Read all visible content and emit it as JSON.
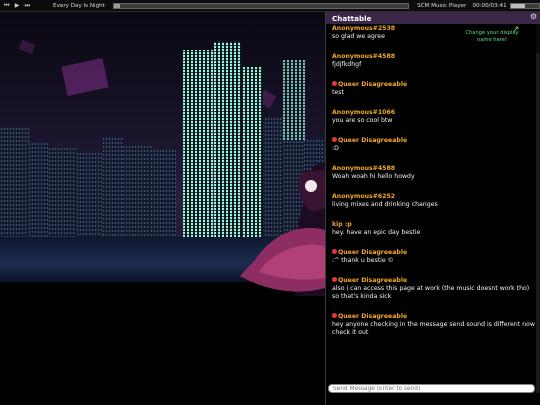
{
  "player": {
    "prev_icon": "skip-back-icon",
    "play_icon": "play-icon",
    "next_icon": "skip-forward-icon",
    "track_title": "Every Day Is Night",
    "progress": 0.02,
    "player_name": "SCM Music Player",
    "time": "00:00/03:41",
    "volume": 0.5
  },
  "chat": {
    "title": "Chattable",
    "settings_icon": "gear-icon",
    "tip": "Change your display name here!",
    "input_placeholder": "Send Message (Enter to send)",
    "colors": {
      "name": "#f0a92c",
      "badge": "#e23a3a",
      "tip": "#5fe07a",
      "header": "#3b2848"
    },
    "messages": [
      {
        "author": "Anonymous#2538",
        "badge": false,
        "text": "so glad we agree"
      },
      {
        "author": "Anonymous#4588",
        "badge": false,
        "text": "fjdjfkdhgf"
      },
      {
        "author": "Queer Disagreeable",
        "badge": true,
        "text": "test"
      },
      {
        "author": "Anonymous#1066",
        "badge": false,
        "text": "you are so cool btw"
      },
      {
        "author": "Queer Disagreeable",
        "badge": true,
        "text": ":D"
      },
      {
        "author": "Anonymous#4588",
        "badge": false,
        "text": "Woah woah hi hello howdy"
      },
      {
        "author": "Anonymous#6252",
        "badge": false,
        "text": "living mixes and drinking changes"
      },
      {
        "author": "kip :p",
        "badge": false,
        "text": "hey. have an epic day bestie"
      },
      {
        "author": "Queer Disagreeable",
        "badge": true,
        "text": ":^ thank u bestie ©"
      },
      {
        "author": "Queer Disagreeable",
        "badge": true,
        "text": "also i can access this page at work (the music doesnt work tho) so that's kinda sick"
      },
      {
        "author": "Queer Disagreeable",
        "badge": true,
        "text": "hey anyone checking in the message send sound is different now check it out"
      }
    ]
  }
}
